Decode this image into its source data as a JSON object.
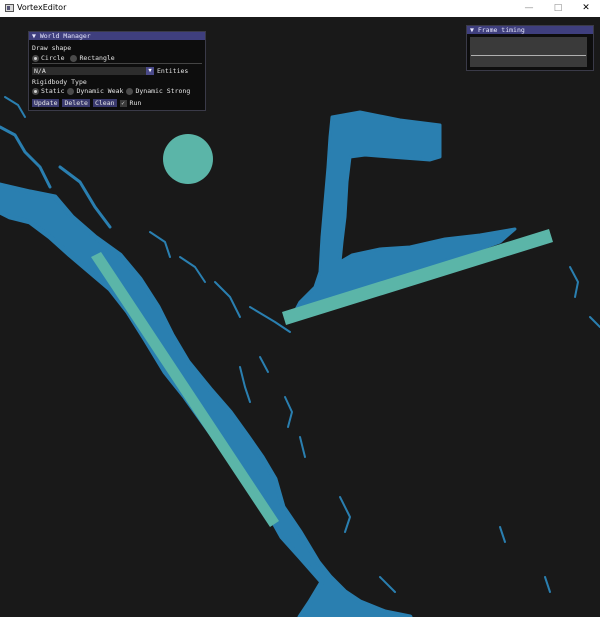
{
  "window": {
    "title": "VortexEditor",
    "minimize": "—",
    "maximize": "□",
    "close": "✕"
  },
  "world_manager": {
    "title": "World Manager",
    "draw_shape_label": "Draw shape",
    "shapes": [
      "Circle",
      "Rectangle"
    ],
    "selected_shape": "Circle",
    "entity_combo_value": "N/A",
    "entity_combo_label": "Entities",
    "rigidbody_label": "Rigidbody Type",
    "rigidbody_types": [
      "Static",
      "Dynamic Weak",
      "Dynamic Strong"
    ],
    "selected_rigidbody": "Static",
    "buttons": [
      "Update",
      "Delete",
      "Clean"
    ],
    "run_label": "Run",
    "run_checked": true
  },
  "frame_timing": {
    "title": "Frame timing"
  },
  "colors": {
    "background": "#191919",
    "fluid": "#2a7fb0",
    "body": "#5bb5a8",
    "panel_title": "#3f3f7e"
  }
}
